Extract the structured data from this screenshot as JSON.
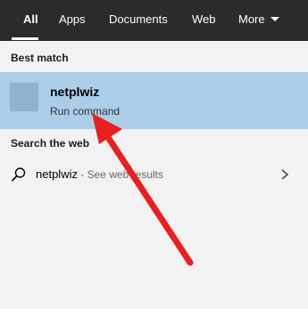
{
  "tabs": [
    {
      "label": "All",
      "active": true
    },
    {
      "label": "Apps"
    },
    {
      "label": "Documents"
    },
    {
      "label": "Web"
    },
    {
      "label": "More"
    }
  ],
  "best_match": {
    "section_label": "Best match",
    "title": "netplwiz",
    "subtitle": "Run command",
    "icon": "app-tile-icon"
  },
  "web": {
    "section_label": "Search the web",
    "query": "netplwiz",
    "suffix": " - See web results",
    "icon": "search-icon"
  },
  "annotation": {
    "type": "red-arrow",
    "color": "#e8201f"
  },
  "colors": {
    "tabbar": "#2b2b2b",
    "selected": "#abcde8",
    "background": "#f2f2f2"
  }
}
